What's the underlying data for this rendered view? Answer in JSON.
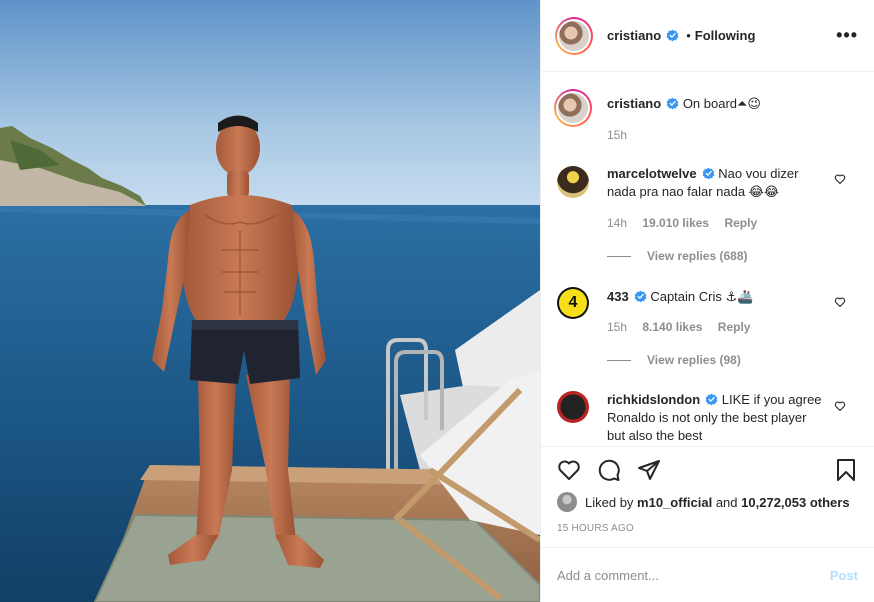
{
  "post": {
    "author": "cristiano",
    "follow_status": "Following",
    "more_icon": "more-horizontal-icon"
  },
  "caption": {
    "username": "cristiano",
    "text": "On board⏶😉",
    "time": "15h"
  },
  "comments": [
    {
      "username": "marcelotwelve",
      "text": "Nao vou dizer nada pra nao falar nada 😂😂",
      "time": "14h",
      "likes": "19.010 likes",
      "reply": "Reply",
      "view_replies": "View replies (688)"
    },
    {
      "username": "433",
      "text": "Captain Cris ⚓🚢",
      "time": "15h",
      "likes": "8.140 likes",
      "reply": "Reply",
      "view_replies": "View replies (98)"
    },
    {
      "username": "richkidslondon",
      "text": "LIKE if you agree Ronaldo is not only the best player but also the best"
    }
  ],
  "liked_by": {
    "prefix": "Liked by",
    "user": "m10_official",
    "middle": "and",
    "count": "10,272,053 others"
  },
  "timestamp": "15 HOURS AGO",
  "add_comment": {
    "placeholder": "Add a comment...",
    "post_label": "Post"
  },
  "colors": {
    "verified": "#3897f0",
    "muted": "#8e8e8e",
    "post_button_disabled": "#b2dffc"
  }
}
